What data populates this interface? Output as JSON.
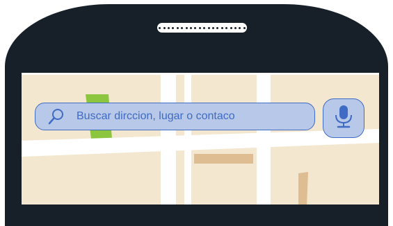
{
  "search": {
    "placeholder": "Buscar dirccion, lugar o contaco"
  },
  "icons": {
    "search": "search-icon",
    "microphone": "microphone-icon"
  },
  "colors": {
    "phone_frame": "#172029",
    "map_land": "#f3e8cf",
    "map_roads": "#ffffff",
    "map_buildings": "#dfbd92",
    "map_park": "#8cc63f",
    "search_fill": "#b7c8e8",
    "search_accent": "#3f6bc4"
  }
}
